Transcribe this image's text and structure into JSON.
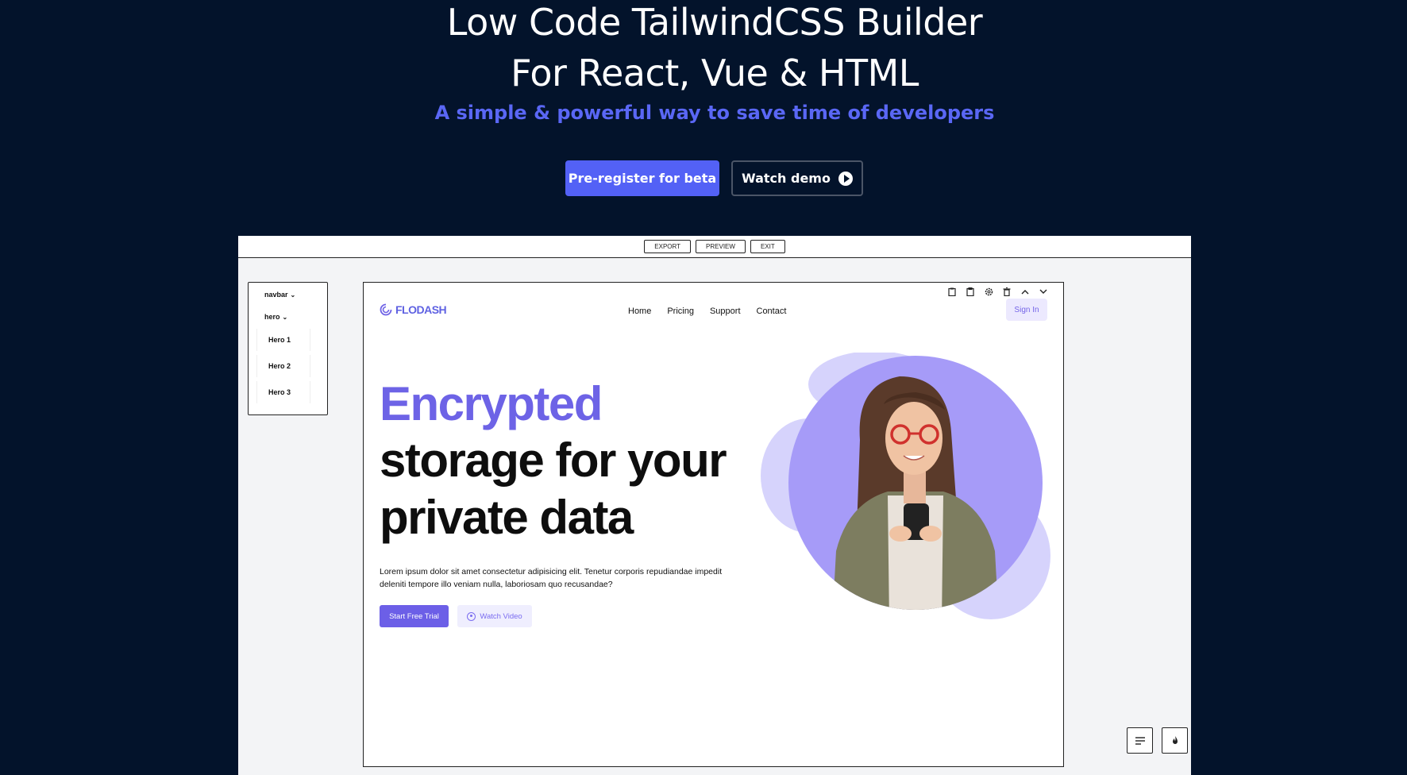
{
  "landing": {
    "title_line1": "Low Code TailwindCSS Builder",
    "title_line2": "For React, Vue & HTML",
    "subtitle": "A simple & powerful way to save time of developers",
    "primary_button": "Pre-register for beta",
    "secondary_button": "Watch demo",
    "accent_color": "#5361f6",
    "background_color": "#03132b"
  },
  "builder_toolbar": {
    "export": "EXPORT",
    "preview": "PREVIEW",
    "exit": "EXIT"
  },
  "layers": {
    "navbar": "navbar",
    "hero": "hero",
    "items": [
      "Hero 1",
      "Hero 2",
      "Hero 3"
    ]
  },
  "preview_toolbar_icons": [
    "clipboard-icon",
    "copy-icon",
    "gear-icon",
    "trash-icon",
    "chevron-up-icon",
    "chevron-down-icon"
  ],
  "site": {
    "logo": "FLODASH",
    "nav": [
      "Home",
      "Pricing",
      "Support",
      "Contact"
    ],
    "signin": "Sign In",
    "headline_accent": "Encrypted",
    "headline_rest": "storage for your private data",
    "paragraph": "Lorem ipsum dolor sit amet consectetur adipisicing elit. Tenetur corporis repudiandae impedit deleniti tempore illo veniam nulla, laboriosam quo recusandae?",
    "cta_primary": "Start Free Trial",
    "cta_secondary": "Watch Video",
    "brand_color": "#6c5fe7"
  },
  "floating_buttons": [
    "text-align-icon",
    "fire-icon"
  ]
}
